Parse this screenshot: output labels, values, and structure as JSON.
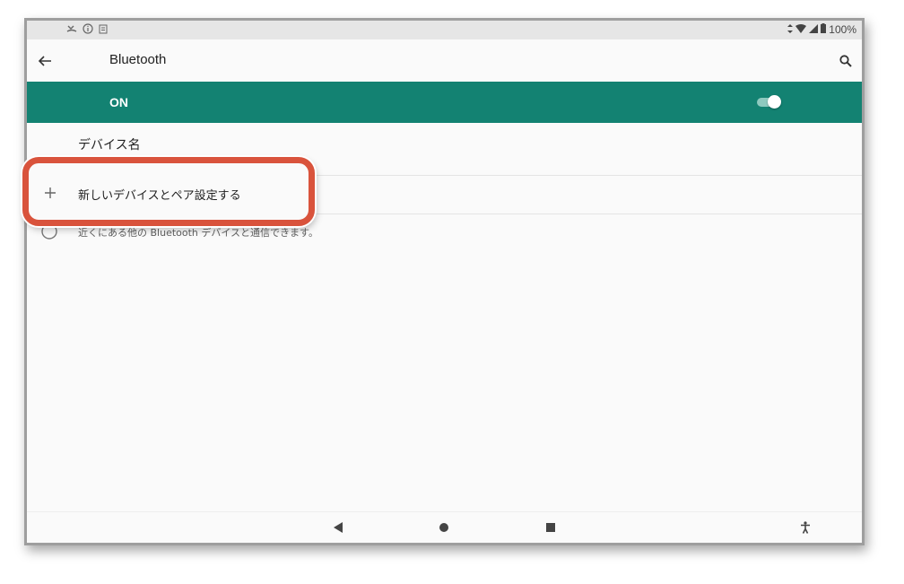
{
  "status_bar": {
    "battery": "100%"
  },
  "app_bar": {
    "title": "Bluetooth"
  },
  "bluetooth_toggle": {
    "label": "ON",
    "enabled": true,
    "accent_color": "#138272"
  },
  "settings": {
    "device_name_label": "デバイス名",
    "pair_new_device_label": "新しいデバイスとペア設定する",
    "info_text": "近くにある他の Bluetooth デバイスと通信できます。"
  },
  "annotation": {
    "highlight_color": "#d9533c"
  },
  "icons": {
    "back": "arrow-back-icon",
    "search": "search-icon",
    "add": "plus-icon",
    "info": "info-icon",
    "nav_back": "triangle-back-icon",
    "nav_home": "circle-home-icon",
    "nav_recents": "square-recents-icon",
    "accessibility": "accessibility-icon"
  }
}
